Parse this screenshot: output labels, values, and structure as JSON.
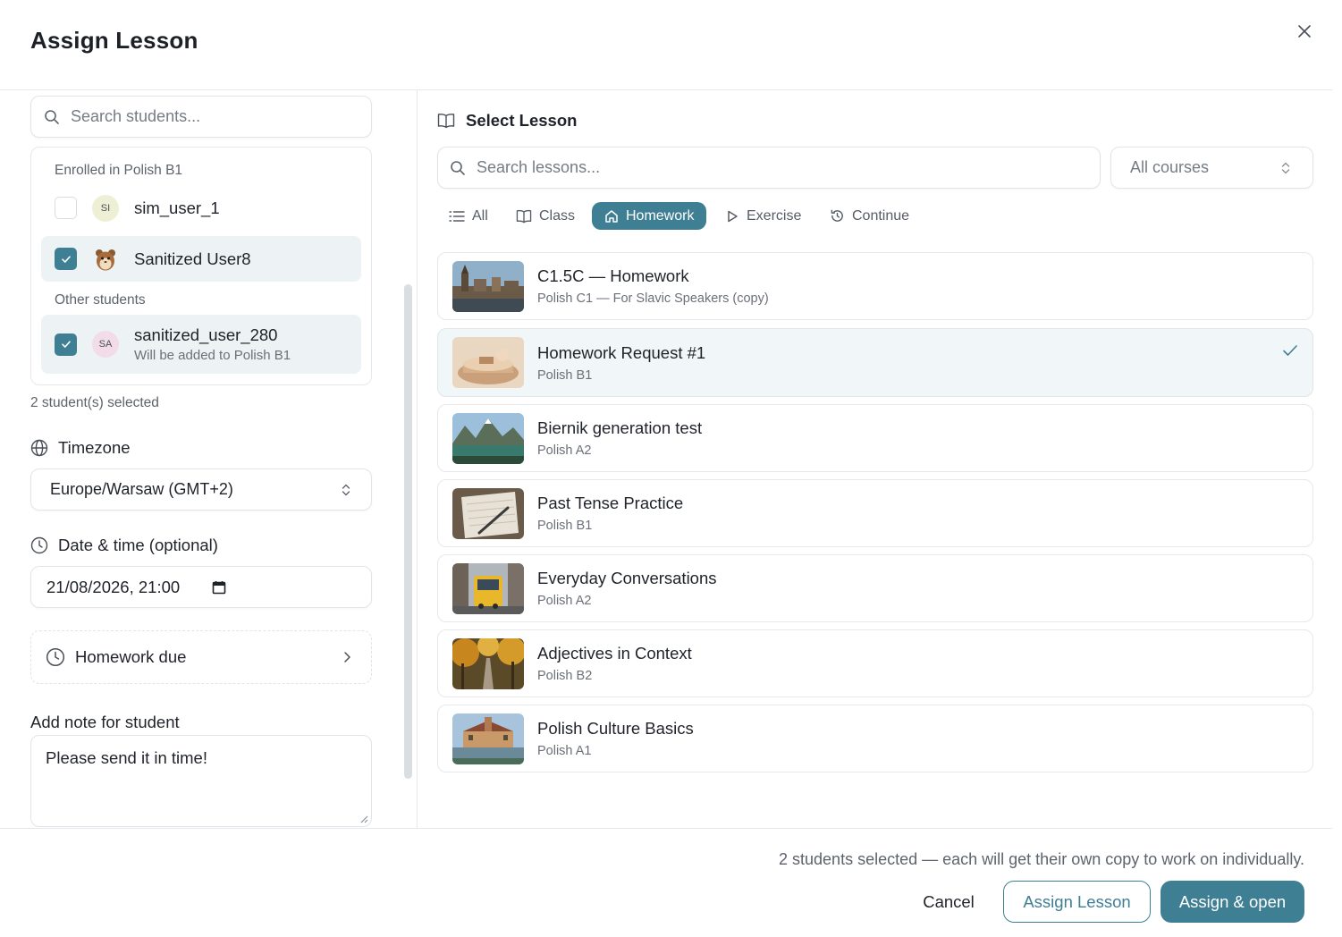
{
  "dialog": {
    "title": "Assign Lesson"
  },
  "students": {
    "search_placeholder": "Search students...",
    "enrolled_label": "Enrolled in Polish B1",
    "other_label": "Other students",
    "enrolled": [
      {
        "name": "sim_user_1",
        "initials": "SI",
        "checked": false
      },
      {
        "name": "Sanitized User8",
        "initials": "",
        "checked": true
      }
    ],
    "others": [
      {
        "name": "sanitized_user_280",
        "initials": "SA",
        "note": "Will be added to Polish B1",
        "checked": true
      }
    ],
    "selected_count": "2 student(s) selected"
  },
  "timezone": {
    "label": "Timezone",
    "value": "Europe/Warsaw (GMT+2)"
  },
  "datetime": {
    "label": "Date & time (optional)",
    "value": "21/08/2026, 21:00"
  },
  "homework_due": {
    "label": "Homework due"
  },
  "note": {
    "label": "Add note for student",
    "value": "Please send it in time!"
  },
  "lessons": {
    "header": "Select Lesson",
    "search_placeholder": "Search lessons...",
    "course_filter": "All courses",
    "tabs": [
      {
        "label": "All",
        "icon": "list-icon",
        "active": false
      },
      {
        "label": "Class",
        "icon": "book-icon",
        "active": false
      },
      {
        "label": "Homework",
        "icon": "home-icon",
        "active": true
      },
      {
        "label": "Exercise",
        "icon": "play-icon",
        "active": false
      },
      {
        "label": "Continue",
        "icon": "history-icon",
        "active": false
      }
    ],
    "items": [
      {
        "title": "C1.5C — Homework",
        "course": "Polish C1 — For Slavic Speakers (copy)",
        "selected": false
      },
      {
        "title": "Homework Request #1",
        "course": "Polish B1",
        "selected": true
      },
      {
        "title": "Biernik generation test",
        "course": "Polish A2",
        "selected": false
      },
      {
        "title": "Past Tense Practice",
        "course": "Polish B1",
        "selected": false
      },
      {
        "title": "Everyday Conversations",
        "course": "Polish A2",
        "selected": false
      },
      {
        "title": "Adjectives in Context",
        "course": "Polish B2",
        "selected": false
      },
      {
        "title": "Polish Culture Basics",
        "course": "Polish A1",
        "selected": false
      }
    ]
  },
  "footer": {
    "summary": "2 students selected — each will get their own copy to work on individually.",
    "cancel": "Cancel",
    "assign": "Assign Lesson",
    "assign_open": "Assign & open"
  },
  "colors": {
    "accent": "#3f7f94",
    "selected_row": "#edf2f4",
    "border": "#e1e4e8"
  }
}
